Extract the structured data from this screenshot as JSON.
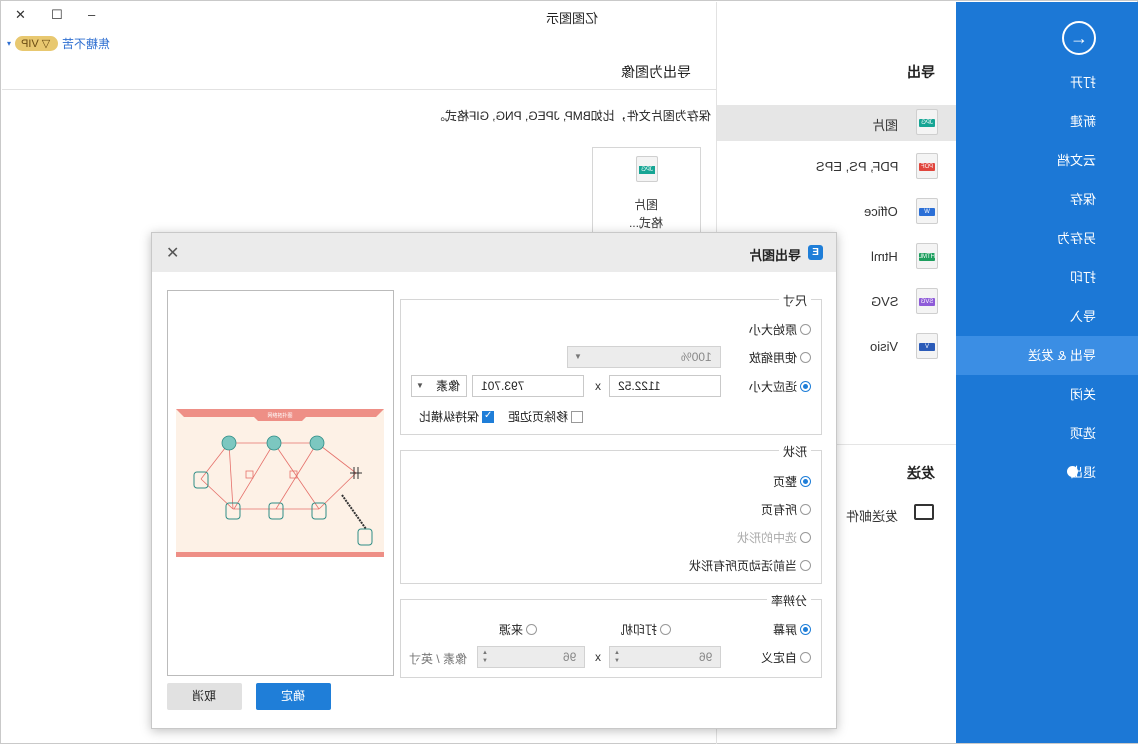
{
  "window": {
    "title": "亿图图示",
    "close_glyph": "✕",
    "maximize_glyph": "☐",
    "minimize_glyph": "‒"
  },
  "account": {
    "vip_label": "VIP",
    "username": "焦糖不苦"
  },
  "sidebar": {
    "items": [
      {
        "label": "打开"
      },
      {
        "label": "新建"
      },
      {
        "label": "云文档"
      },
      {
        "label": "保存"
      },
      {
        "label": "另存为"
      },
      {
        "label": "打印"
      },
      {
        "label": "导入"
      },
      {
        "label": "导出 & 发送"
      },
      {
        "label": "关闭"
      },
      {
        "label": "选项"
      },
      {
        "label": "退出"
      }
    ],
    "active_index": 7,
    "color": "#1c78d6"
  },
  "export_nav": {
    "heading": "导出",
    "items": [
      {
        "label": "图片",
        "icon": "jpg-file-icon",
        "tag": "JPG",
        "tag_color": "#16a594"
      },
      {
        "label": "PDF, PS, EPS",
        "icon": "pdf-file-icon",
        "tag": "PDF",
        "tag_color": "#e0463d"
      },
      {
        "label": "Office",
        "icon": "word-file-icon",
        "tag": "W",
        "tag_color": "#2b6fd6"
      },
      {
        "label": "Html",
        "icon": "html-file-icon",
        "tag": "HTML",
        "tag_color": "#1d9e5e"
      },
      {
        "label": "SVG",
        "icon": "svg-file-icon",
        "tag": "SVG",
        "tag_color": "#8e5bd8"
      },
      {
        "label": "Visio",
        "icon": "visio-file-icon",
        "tag": "V",
        "tag_color": "#2b5bb8"
      }
    ],
    "send_heading": "发送",
    "send_email": "发送邮件"
  },
  "main": {
    "title": "导出为图像",
    "description": "保存为图片文件，比如BMP, JPEG, PNG, GIF格式。",
    "card_line1": "图片",
    "card_line2": "格式...",
    "card_tag": "JPG"
  },
  "dialog": {
    "title": "导出图片",
    "logo_text": "E",
    "close_glyph": "✕",
    "size": {
      "title": "尺寸",
      "original": "原始大小",
      "use_zoom": "使用缩放",
      "zoom_value": "100%",
      "fit": "适应大小",
      "width": "1122.52",
      "height": "793.701",
      "unit": "像素",
      "x": "x",
      "remove_margin": "移除页边距",
      "keep_ratio": "保持纵横比"
    },
    "shape": {
      "title": "形状",
      "whole_page": "整页",
      "all_pages": "所有页",
      "selected": "选中的形状",
      "current_page_all": "当前活动页所有形状"
    },
    "resolution": {
      "title": "分辨率",
      "screen": "屏幕",
      "printer": "打印机",
      "source": "来源",
      "custom": "自定义",
      "dpi_x": "96",
      "dpi_y": "96",
      "x": "x",
      "unit": "像素 / 英寸"
    },
    "ok": "确定",
    "cancel": "取消"
  },
  "preview": {
    "banner_text": "网络拓扑图"
  }
}
